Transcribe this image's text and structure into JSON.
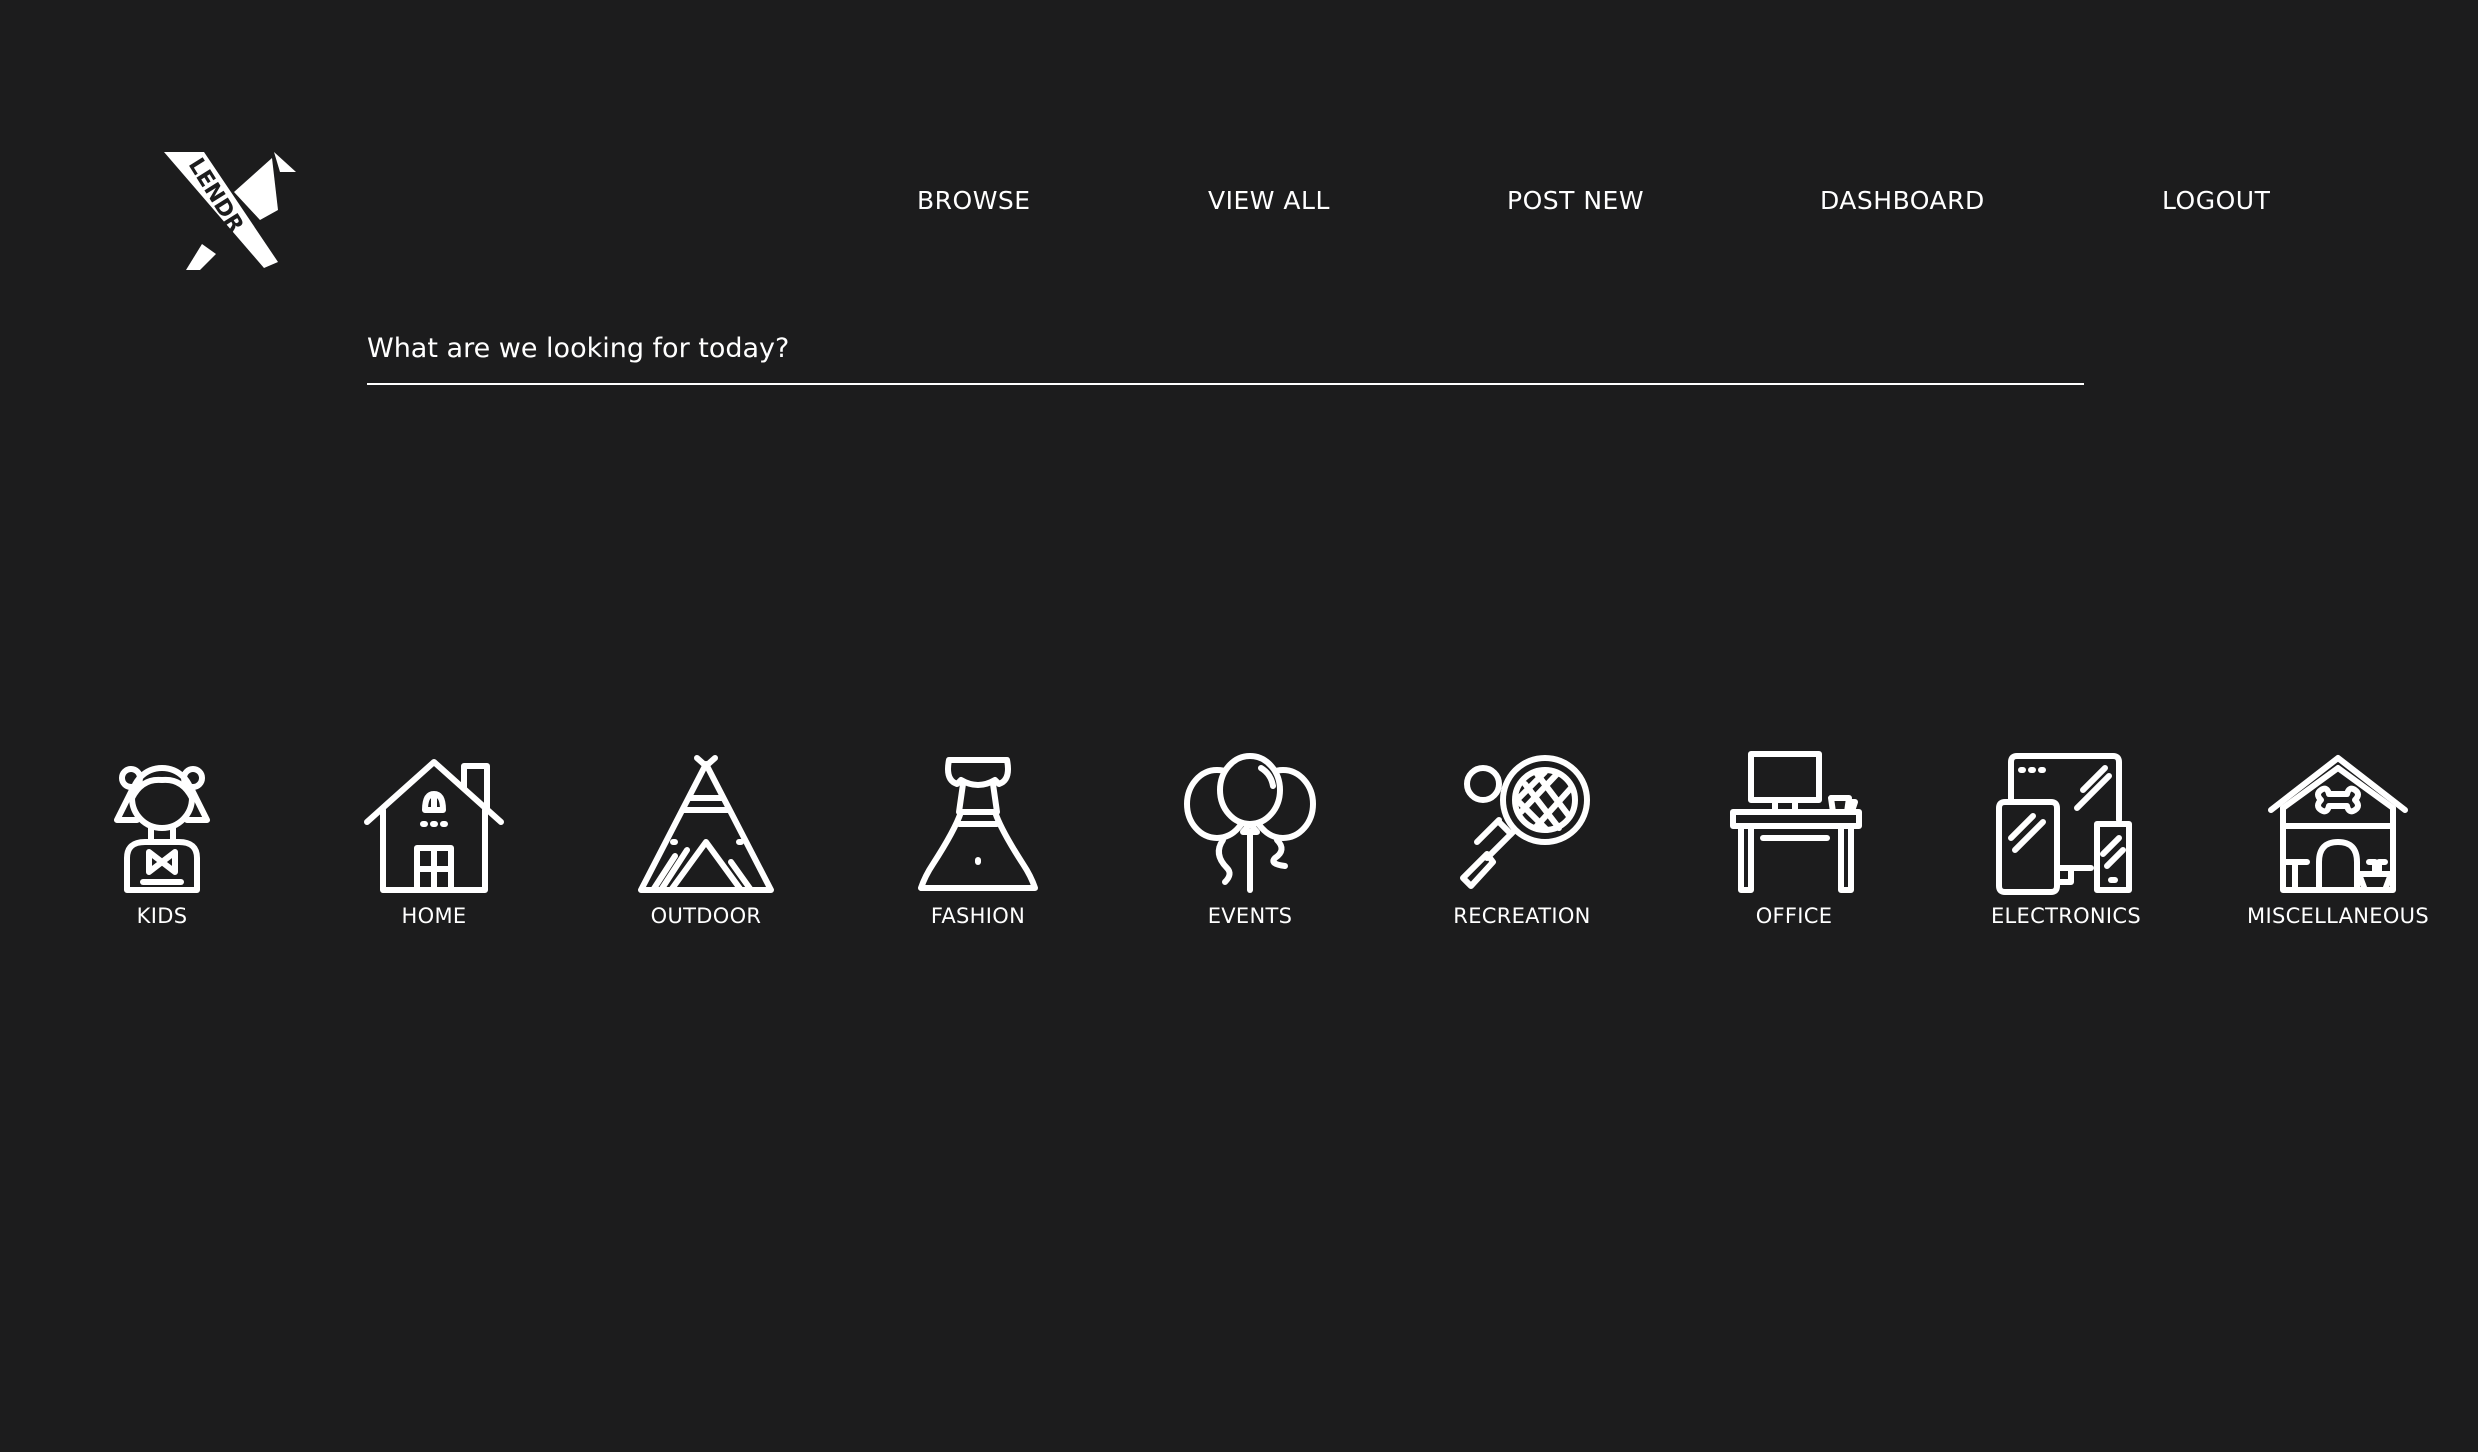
{
  "brand": {
    "logo_text": "LENDR"
  },
  "nav": {
    "items": [
      {
        "label": "BROWSE"
      },
      {
        "label": "VIEW ALL"
      },
      {
        "label": "POST NEW"
      },
      {
        "label": "DASHBOARD"
      },
      {
        "label": "LOGOUT"
      }
    ]
  },
  "search": {
    "placeholder": "What are we looking for today?"
  },
  "categories": [
    {
      "label": "KIDS",
      "icon": "kids-icon"
    },
    {
      "label": "HOME",
      "icon": "house-icon"
    },
    {
      "label": "OUTDOOR",
      "icon": "tent-icon"
    },
    {
      "label": "FASHION",
      "icon": "dress-icon"
    },
    {
      "label": "EVENTS",
      "icon": "balloons-icon"
    },
    {
      "label": "RECREATION",
      "icon": "tennis-racket-icon"
    },
    {
      "label": "OFFICE",
      "icon": "desk-icon"
    },
    {
      "label": "ELECTRONICS",
      "icon": "devices-icon"
    },
    {
      "label": "MISCELLANEOUS",
      "icon": "doghouse-icon"
    }
  ],
  "colors": {
    "background": "#1c1c1d",
    "foreground": "#ffffff"
  }
}
